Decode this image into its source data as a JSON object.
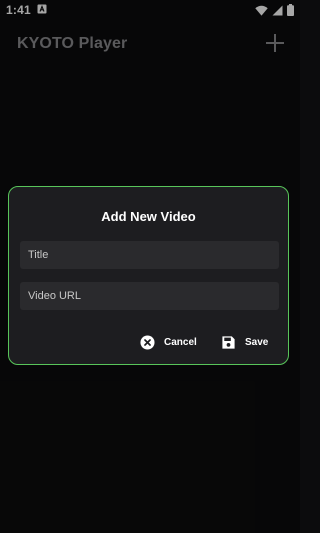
{
  "status_bar": {
    "time": "1:41",
    "icons": [
      "notification-a-icon",
      "wifi-icon",
      "signal-icon",
      "battery-icon"
    ]
  },
  "app_bar": {
    "title": "KYOTO Player",
    "add_icon": "plus-icon"
  },
  "dialog": {
    "title": "Add New Video",
    "title_field": {
      "placeholder": "Title",
      "value": ""
    },
    "url_field": {
      "placeholder": "Video URL",
      "value": ""
    },
    "cancel_label": "Cancel",
    "cancel_icon": "close-circle-icon",
    "save_label": "Save",
    "save_icon": "save-floppy-icon"
  },
  "colors": {
    "background": "#0c0c0d",
    "dialog_background": "#1d1d20",
    "dialog_border": "#58c55a",
    "field_background": "#2a2a2d",
    "app_title": "#8a8a8e"
  }
}
